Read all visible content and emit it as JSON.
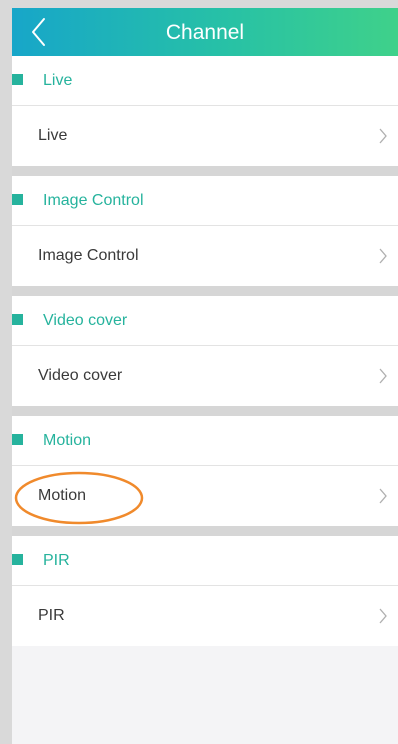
{
  "header": {
    "title": "Channel",
    "back_icon": "chevron-left-icon"
  },
  "sections": [
    {
      "title": "Live",
      "item": "Live"
    },
    {
      "title": "Image Control",
      "item": "Image Control"
    },
    {
      "title": "Video cover",
      "item": "Video cover"
    },
    {
      "title": "Motion",
      "item": "Motion"
    },
    {
      "title": "PIR",
      "item": "PIR"
    }
  ],
  "row_icon": "chevron-right-icon",
  "colors": {
    "accent": "#26b39d",
    "header_gradient_start": "#17a6c9",
    "header_gradient_end": "#3fd18a",
    "annotation": "#f08a2c"
  }
}
